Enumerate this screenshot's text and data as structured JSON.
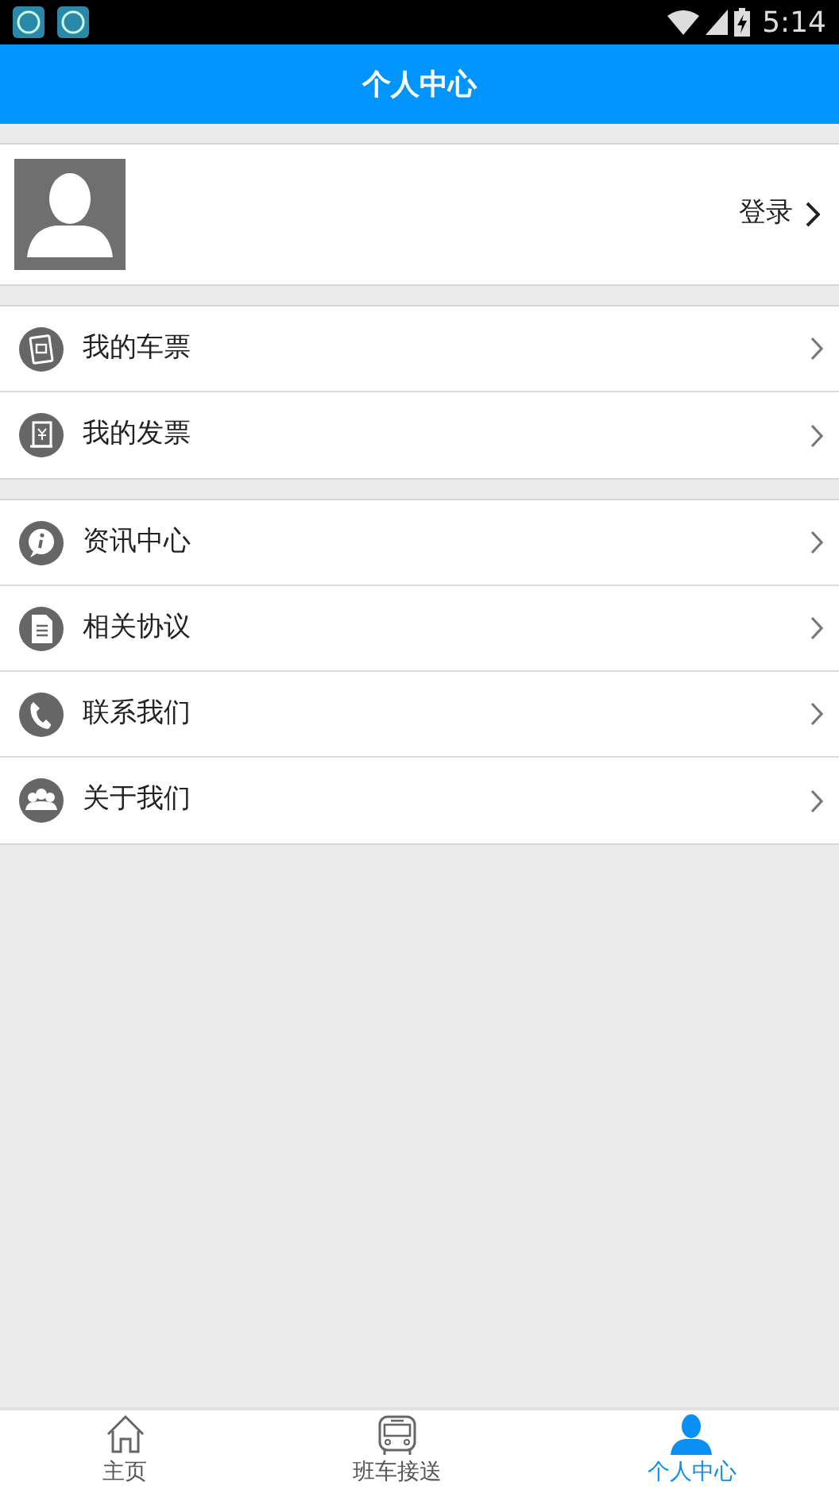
{
  "status_bar": {
    "time": "5:14"
  },
  "header": {
    "title": "个人中心"
  },
  "profile": {
    "login": "登录"
  },
  "menu_groups": [
    [
      {
        "kind": "ticket",
        "label": "我的车票"
      },
      {
        "kind": "invoice",
        "label": "我的发票"
      }
    ],
    [
      {
        "kind": "info",
        "label": "资讯中心"
      },
      {
        "kind": "document",
        "label": "相关协议"
      },
      {
        "kind": "phone",
        "label": "联系我们"
      },
      {
        "kind": "people",
        "label": "关于我们"
      }
    ]
  ],
  "tab_bar": [
    {
      "kind": "home",
      "label": "主页",
      "selected": false
    },
    {
      "kind": "bus",
      "label": "班车接送",
      "selected": false
    },
    {
      "kind": "person",
      "label": "个人中心",
      "selected": true
    }
  ]
}
